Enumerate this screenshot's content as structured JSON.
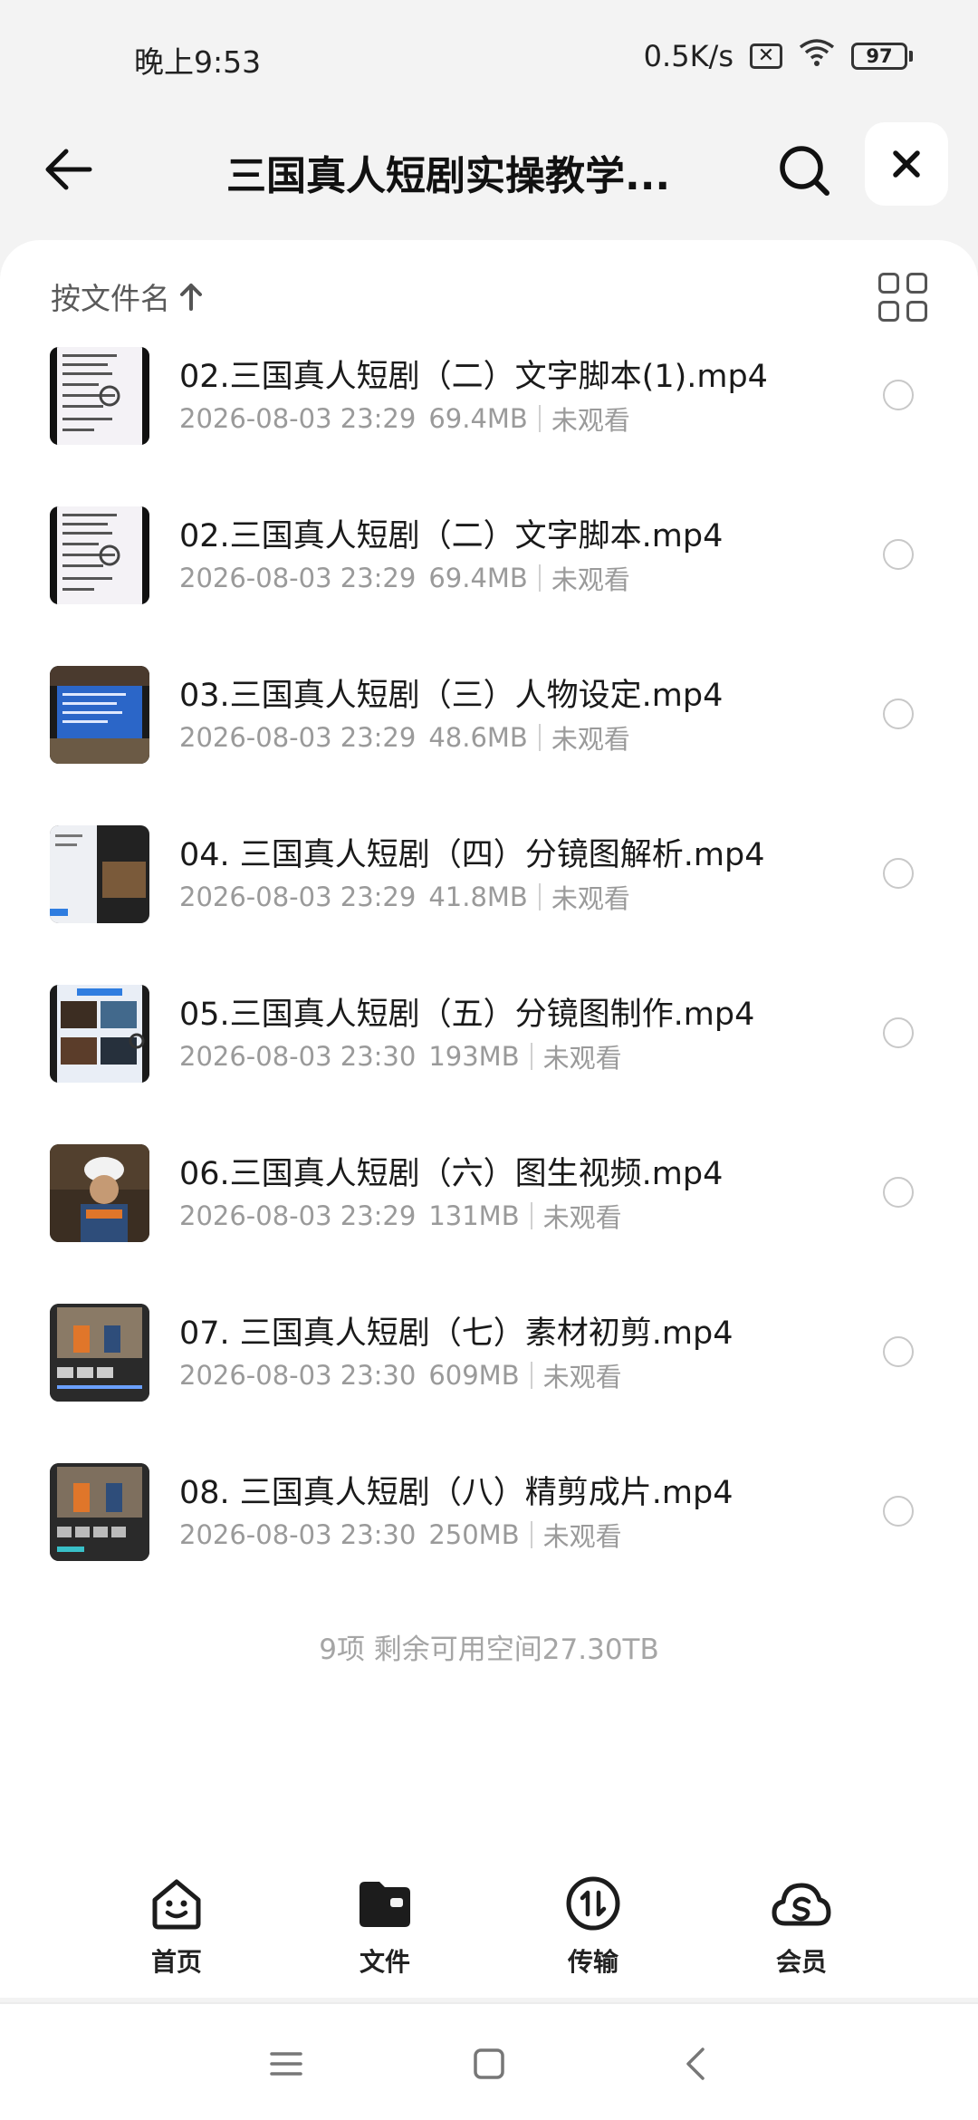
{
  "status_bar": {
    "time": "晚上9:53",
    "network_speed": "0.5K/s",
    "battery": "97",
    "icons": [
      "sim-x-icon",
      "wifi-icon",
      "battery-icon"
    ]
  },
  "header": {
    "title": "三国真人短剧实操教学...",
    "icons": [
      "back-arrow-icon",
      "search-icon",
      "close-icon"
    ]
  },
  "sort": {
    "label": "按文件名",
    "direction_icon": "arrow-up-icon"
  },
  "files": [
    {
      "name": "02.三国真人短剧（二）文字脚本(1).mp4",
      "date": "2026-08-03 23:29",
      "size": "69.4MB",
      "status": "未观看",
      "thumb": "doc"
    },
    {
      "name": "02.三国真人短剧（二）文字脚本.mp4",
      "date": "2026-08-03 23:29",
      "size": "69.4MB",
      "status": "未观看",
      "thumb": "doc"
    },
    {
      "name": "03.三国真人短剧（三）人物设定.mp4",
      "date": "2026-08-03 23:29",
      "size": "48.6MB",
      "status": "未观看",
      "thumb": "blue"
    },
    {
      "name": "04. 三国真人短剧（四）分镜图解析.mp4",
      "date": "2026-08-03 23:29",
      "size": "41.8MB",
      "status": "未观看",
      "thumb": "split"
    },
    {
      "name": "05.三国真人短剧（五）分镜图制作.mp4",
      "date": "2026-08-03 23:30",
      "size": "193MB",
      "status": "未观看",
      "thumb": "collage"
    },
    {
      "name": "06.三国真人短剧（六）图生视频.mp4",
      "date": "2026-08-03 23:29",
      "size": "131MB",
      "status": "未观看",
      "thumb": "worker"
    },
    {
      "name": "07. 三国真人短剧（七）素材初剪.mp4",
      "date": "2026-08-03 23:30",
      "size": "609MB",
      "status": "未观看",
      "thumb": "editor"
    },
    {
      "name": "08. 三国真人短剧（八）精剪成片.mp4",
      "date": "2026-08-03 23:30",
      "size": "250MB",
      "status": "未观看",
      "thumb": "editor"
    }
  ],
  "summary": "9项 剩余可用空间27.30TB",
  "tabs": [
    {
      "label": "首页",
      "icon": "home-smile-icon"
    },
    {
      "label": "文件",
      "icon": "folder-icon"
    },
    {
      "label": "传输",
      "icon": "transfer-icon"
    },
    {
      "label": "会员",
      "icon": "vip-cloud-icon"
    }
  ],
  "nav_icons": [
    "menu-icon",
    "home-square-icon",
    "back-chevron-icon"
  ],
  "colors": {
    "background": "#f3f3f3",
    "sheet": "#ffffff",
    "meta_text": "#9a9a9a",
    "summary_text": "#a5a5a5"
  }
}
